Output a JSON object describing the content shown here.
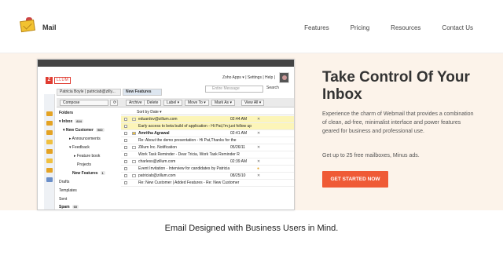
{
  "brand": {
    "name": "Mail",
    "logo_icon": "envelope-mascot-icon"
  },
  "nav": {
    "items": [
      "Features",
      "Pricing",
      "Resources",
      "Contact Us"
    ]
  },
  "hero": {
    "headline": "Take Control Of Your Inbox",
    "description": "Experience the charm of Webmail that provides a combination of clean, ad-free, minimalist interface and power features geared for business and professional use.",
    "subtext": "Get up to 25 free mailboxes, Minus ads.",
    "cta": "GET STARTED NOW"
  },
  "screenshot": {
    "logo": {
      "letter": "Z",
      "word": "LLUM"
    },
    "top_links": "Zoho Apps ▾ | Settings | Help |",
    "search_placeholder": "Entire Message",
    "search_button": "Search",
    "user_tab": "Patricia Boyle | patriciab@zilly...",
    "new_tab": "New Features",
    "toolbar": {
      "compose": "Compose",
      "archive": "Archive",
      "delete": "Delete",
      "label": "Label ▾",
      "move_to": "Move To ▾",
      "mark_as": "Mark As ▾",
      "view_all": "View All ▾"
    },
    "folders": [
      {
        "label": "Folders",
        "bold": true
      },
      {
        "label": "▾ Inbox",
        "badge": "824",
        "bold": true
      },
      {
        "label": "▾ New Customer",
        "badge": "960",
        "bold": true
      },
      {
        "label": "▸ Announcements",
        "bold": false
      },
      {
        "label": "▾ Feedback",
        "bold": false
      },
      {
        "label": "▸ Feature book",
        "bold": false
      },
      {
        "label": "Projects",
        "bold": false
      },
      {
        "label": "New Features",
        "badge": "1",
        "bold": true
      },
      {
        "label": "Drafts",
        "bold": false
      },
      {
        "label": "Templates",
        "bold": false
      },
      {
        "label": "Sent",
        "bold": false
      },
      {
        "label": "Spam",
        "badge": "60",
        "bold": true
      }
    ],
    "list_header": "Sort by Date ▾",
    "rows": [
      {
        "text": "eduardov@zillum.com",
        "date": "02:44 AM",
        "highlight": true
      },
      {
        "text": "Early access to beta build of application - Hi Pat,I'm just follow up",
        "date": "",
        "highlight": true
      },
      {
        "text": "Amritha Agrawal",
        "date": "02:41 AM",
        "highlight": false
      },
      {
        "text": "Re: About the demo presentation - Hi Pat,Thanks for the",
        "date": "",
        "highlight": false
      },
      {
        "text": "Zillum Inc. Notification",
        "date": "05/26/11",
        "highlight": false
      },
      {
        "text": "Work Task Reminder - Dear Tricia, Work Task Reminder R",
        "date": "",
        "highlight": false
      },
      {
        "text": "charless@zillum.com",
        "date": "02:39 AM",
        "highlight": false
      },
      {
        "text": "Event Invitation - Interview for candidates by Patricia",
        "date": "",
        "highlight": false
      },
      {
        "text": "patriciab@zillum.com",
        "date": "08/25/10",
        "highlight": false
      },
      {
        "text": "Re: New Customer | Added Features - Re: New Customer",
        "date": "",
        "highlight": false
      }
    ]
  },
  "footer": {
    "tagline": "Email Designed with Business Users in Mind."
  },
  "colors": {
    "hero_bg": "#fcf3ea",
    "cta": "#ef5a36",
    "highlight_row": "#fcf5b8",
    "zillum_red": "#e03c31"
  }
}
